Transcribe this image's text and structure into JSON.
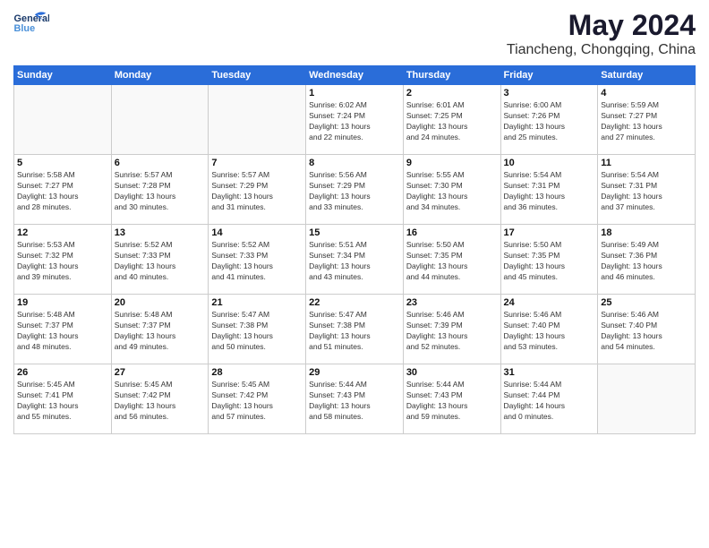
{
  "header": {
    "logo_line1": "General",
    "logo_line2": "Blue",
    "month": "May 2024",
    "location": "Tiancheng, Chongqing, China"
  },
  "days_of_week": [
    "Sunday",
    "Monday",
    "Tuesday",
    "Wednesday",
    "Thursday",
    "Friday",
    "Saturday"
  ],
  "weeks": [
    [
      {
        "day": "",
        "info": ""
      },
      {
        "day": "",
        "info": ""
      },
      {
        "day": "",
        "info": ""
      },
      {
        "day": "1",
        "info": "Sunrise: 6:02 AM\nSunset: 7:24 PM\nDaylight: 13 hours\nand 22 minutes."
      },
      {
        "day": "2",
        "info": "Sunrise: 6:01 AM\nSunset: 7:25 PM\nDaylight: 13 hours\nand 24 minutes."
      },
      {
        "day": "3",
        "info": "Sunrise: 6:00 AM\nSunset: 7:26 PM\nDaylight: 13 hours\nand 25 minutes."
      },
      {
        "day": "4",
        "info": "Sunrise: 5:59 AM\nSunset: 7:27 PM\nDaylight: 13 hours\nand 27 minutes."
      }
    ],
    [
      {
        "day": "5",
        "info": "Sunrise: 5:58 AM\nSunset: 7:27 PM\nDaylight: 13 hours\nand 28 minutes."
      },
      {
        "day": "6",
        "info": "Sunrise: 5:57 AM\nSunset: 7:28 PM\nDaylight: 13 hours\nand 30 minutes."
      },
      {
        "day": "7",
        "info": "Sunrise: 5:57 AM\nSunset: 7:29 PM\nDaylight: 13 hours\nand 31 minutes."
      },
      {
        "day": "8",
        "info": "Sunrise: 5:56 AM\nSunset: 7:29 PM\nDaylight: 13 hours\nand 33 minutes."
      },
      {
        "day": "9",
        "info": "Sunrise: 5:55 AM\nSunset: 7:30 PM\nDaylight: 13 hours\nand 34 minutes."
      },
      {
        "day": "10",
        "info": "Sunrise: 5:54 AM\nSunset: 7:31 PM\nDaylight: 13 hours\nand 36 minutes."
      },
      {
        "day": "11",
        "info": "Sunrise: 5:54 AM\nSunset: 7:31 PM\nDaylight: 13 hours\nand 37 minutes."
      }
    ],
    [
      {
        "day": "12",
        "info": "Sunrise: 5:53 AM\nSunset: 7:32 PM\nDaylight: 13 hours\nand 39 minutes."
      },
      {
        "day": "13",
        "info": "Sunrise: 5:52 AM\nSunset: 7:33 PM\nDaylight: 13 hours\nand 40 minutes."
      },
      {
        "day": "14",
        "info": "Sunrise: 5:52 AM\nSunset: 7:33 PM\nDaylight: 13 hours\nand 41 minutes."
      },
      {
        "day": "15",
        "info": "Sunrise: 5:51 AM\nSunset: 7:34 PM\nDaylight: 13 hours\nand 43 minutes."
      },
      {
        "day": "16",
        "info": "Sunrise: 5:50 AM\nSunset: 7:35 PM\nDaylight: 13 hours\nand 44 minutes."
      },
      {
        "day": "17",
        "info": "Sunrise: 5:50 AM\nSunset: 7:35 PM\nDaylight: 13 hours\nand 45 minutes."
      },
      {
        "day": "18",
        "info": "Sunrise: 5:49 AM\nSunset: 7:36 PM\nDaylight: 13 hours\nand 46 minutes."
      }
    ],
    [
      {
        "day": "19",
        "info": "Sunrise: 5:48 AM\nSunset: 7:37 PM\nDaylight: 13 hours\nand 48 minutes."
      },
      {
        "day": "20",
        "info": "Sunrise: 5:48 AM\nSunset: 7:37 PM\nDaylight: 13 hours\nand 49 minutes."
      },
      {
        "day": "21",
        "info": "Sunrise: 5:47 AM\nSunset: 7:38 PM\nDaylight: 13 hours\nand 50 minutes."
      },
      {
        "day": "22",
        "info": "Sunrise: 5:47 AM\nSunset: 7:38 PM\nDaylight: 13 hours\nand 51 minutes."
      },
      {
        "day": "23",
        "info": "Sunrise: 5:46 AM\nSunset: 7:39 PM\nDaylight: 13 hours\nand 52 minutes."
      },
      {
        "day": "24",
        "info": "Sunrise: 5:46 AM\nSunset: 7:40 PM\nDaylight: 13 hours\nand 53 minutes."
      },
      {
        "day": "25",
        "info": "Sunrise: 5:46 AM\nSunset: 7:40 PM\nDaylight: 13 hours\nand 54 minutes."
      }
    ],
    [
      {
        "day": "26",
        "info": "Sunrise: 5:45 AM\nSunset: 7:41 PM\nDaylight: 13 hours\nand 55 minutes."
      },
      {
        "day": "27",
        "info": "Sunrise: 5:45 AM\nSunset: 7:42 PM\nDaylight: 13 hours\nand 56 minutes."
      },
      {
        "day": "28",
        "info": "Sunrise: 5:45 AM\nSunset: 7:42 PM\nDaylight: 13 hours\nand 57 minutes."
      },
      {
        "day": "29",
        "info": "Sunrise: 5:44 AM\nSunset: 7:43 PM\nDaylight: 13 hours\nand 58 minutes."
      },
      {
        "day": "30",
        "info": "Sunrise: 5:44 AM\nSunset: 7:43 PM\nDaylight: 13 hours\nand 59 minutes."
      },
      {
        "day": "31",
        "info": "Sunrise: 5:44 AM\nSunset: 7:44 PM\nDaylight: 14 hours\nand 0 minutes."
      },
      {
        "day": "",
        "info": ""
      }
    ]
  ]
}
